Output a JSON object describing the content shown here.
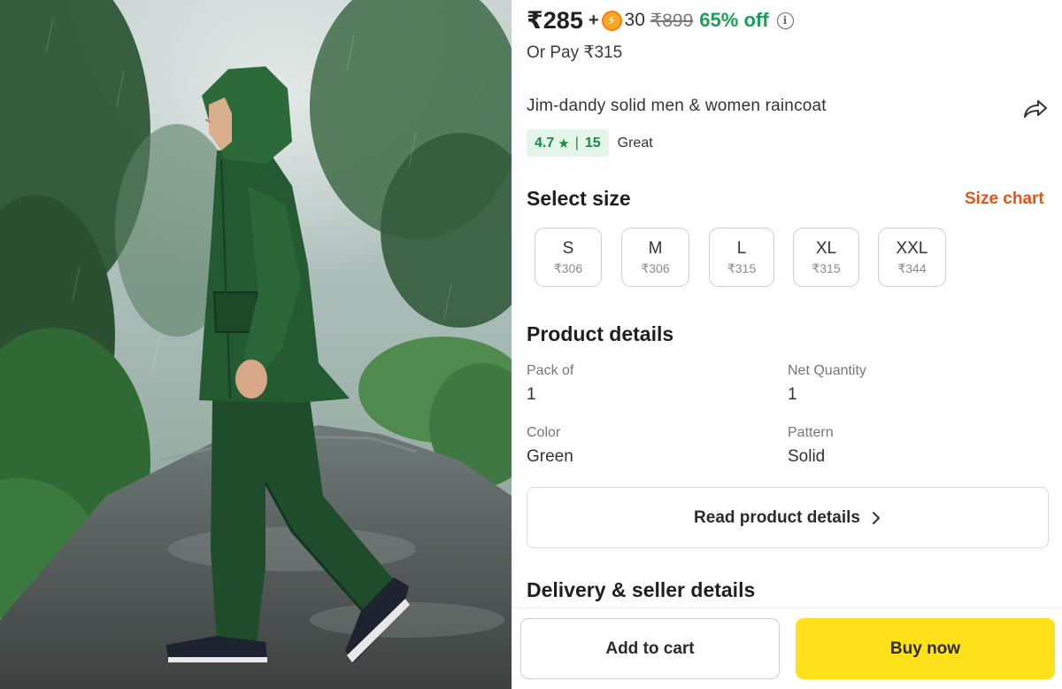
{
  "product": {
    "price": "₹285",
    "plus": "+",
    "coin_symbol": "⚡",
    "coins": "30",
    "mrp": "₹899",
    "discount": "65% off",
    "or_pay": "Or Pay ₹315",
    "title": "Jim-dandy solid men & women raincoat",
    "rating": {
      "value": "4.7",
      "star": "★",
      "separator": "|",
      "count": "15",
      "label": "Great"
    }
  },
  "size_section": {
    "heading": "Select size",
    "size_chart_link": "Size chart",
    "sizes": [
      {
        "label": "S",
        "price": "₹306"
      },
      {
        "label": "M",
        "price": "₹306"
      },
      {
        "label": "L",
        "price": "₹315"
      },
      {
        "label": "XL",
        "price": "₹315"
      },
      {
        "label": "XXL",
        "price": "₹344"
      }
    ]
  },
  "details": {
    "heading": "Product details",
    "items": [
      {
        "key": "Pack of",
        "value": "1"
      },
      {
        "key": "Net Quantity",
        "value": "1"
      },
      {
        "key": "Color",
        "value": "Green"
      },
      {
        "key": "Pattern",
        "value": "Solid"
      }
    ],
    "read_more": "Read product details"
  },
  "delivery": {
    "heading": "Delivery & seller details"
  },
  "actions": {
    "add_to_cart": "Add to cart",
    "buy_now": "Buy now"
  },
  "colors": {
    "discount_green": "#1a9f55",
    "rating_bg": "#e3f6e9",
    "size_chart_orange": "#e0571b",
    "buy_yellow": "#ffe11b",
    "raincoat_green": "#1f4d2b"
  },
  "icons": {
    "coin": "lightning-coin-icon",
    "info": "info-icon",
    "share": "share-arrow-icon",
    "star": "star-icon",
    "chevron": "chevron-right-icon"
  }
}
